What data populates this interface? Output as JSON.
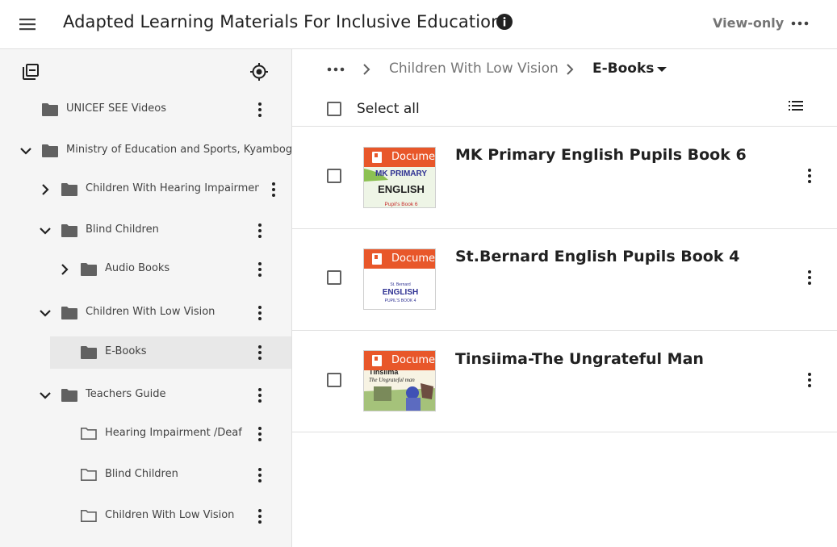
{
  "header": {
    "title": "Adapted Learning Materials For Inclusive Education",
    "view_only": "View-only"
  },
  "sidebar": {
    "tree": [
      {
        "label": "UNICEF SEE Videos",
        "expanded": null,
        "folder": "filled"
      },
      {
        "label": "Ministry of Education and Sports, Kyambogo U",
        "expanded": true,
        "folder": "filled"
      },
      {
        "label": "Children With Hearing Impairment",
        "expanded": false,
        "folder": "filled"
      },
      {
        "label": "Blind Children",
        "expanded": true,
        "folder": "filled"
      },
      {
        "label": "Audio Books",
        "expanded": false,
        "folder": "filled"
      },
      {
        "label": "Children With Low Vision",
        "expanded": true,
        "folder": "filled"
      },
      {
        "label": "E-Books",
        "expanded": null,
        "folder": "filled",
        "selected": true
      },
      {
        "label": "Teachers Guide",
        "expanded": true,
        "folder": "filled"
      },
      {
        "label": "Hearing Impairment /Deaf",
        "expanded": null,
        "folder": "outline"
      },
      {
        "label": "Blind Children",
        "expanded": null,
        "folder": "outline"
      },
      {
        "label": "Children With Low Vision",
        "expanded": null,
        "folder": "outline"
      }
    ]
  },
  "breadcrumb": {
    "parent": "Children With Low Vision",
    "current": "E-Books"
  },
  "toolbar": {
    "select_all": "Select all"
  },
  "items": [
    {
      "title": "MK Primary English Pupils Book 6",
      "badge": "Document",
      "cover_lines": [
        "MK PRIMARY",
        "ENGLISH",
        "Pupil's Book 6"
      ]
    },
    {
      "title": "St.Bernard English Pupils Book 4",
      "badge": "Document",
      "cover_lines": [
        "St. Bernard",
        "ENGLISH",
        "PUPIL'S BOOK 4"
      ]
    },
    {
      "title": "Tinsiima-The Ungrateful Man",
      "badge": "Document",
      "cover_lines": [
        "Tinsiima",
        "The Ungrateful man"
      ]
    }
  ],
  "colors": {
    "accent": "#e8572a",
    "icon": "#616161",
    "sidebar_bg": "#f5f5f5",
    "selected_bg": "#e8e8e8"
  },
  "icons": {
    "menu": "hamburger-icon",
    "info": "info-icon",
    "more": "more-horiz-icon",
    "kebab": "more-vert-icon",
    "folder": "folder-icon",
    "chevron": "chevron-icon",
    "locate": "locate-icon",
    "collapse_all": "collapse-all-icon",
    "list_view": "list-view-icon",
    "document": "document-icon"
  }
}
